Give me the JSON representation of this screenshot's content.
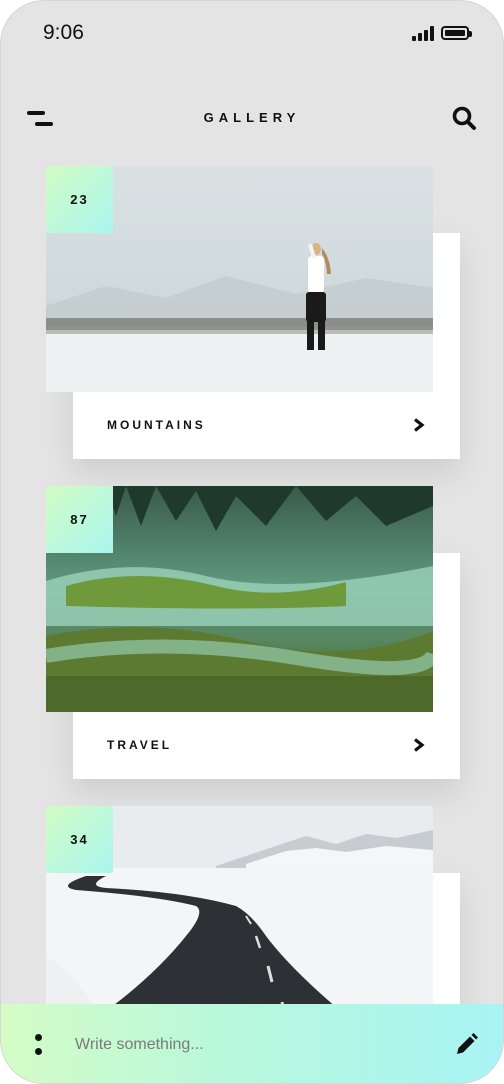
{
  "status_bar": {
    "time": "9:06"
  },
  "header": {
    "title": "GALLERY",
    "menu_icon": "menu-icon",
    "search_icon": "search-icon"
  },
  "cards": [
    {
      "count": "23",
      "label": "MOUNTAINS",
      "image": "woman standing on snowy field"
    },
    {
      "count": "87",
      "label": "TRAVEL",
      "image": "steaming green hot spring field"
    },
    {
      "count": "34",
      "label": "",
      "image": "winding road through snowy landscape"
    }
  ],
  "composer": {
    "placeholder": "Write something...",
    "more_icon": "more-vertical-icon",
    "send_icon": "pencil-icon"
  },
  "colors": {
    "background": "#e4e4e4",
    "accent_start": "#d2fcc4",
    "accent_end": "#a9f6ee",
    "text": "#111111"
  }
}
